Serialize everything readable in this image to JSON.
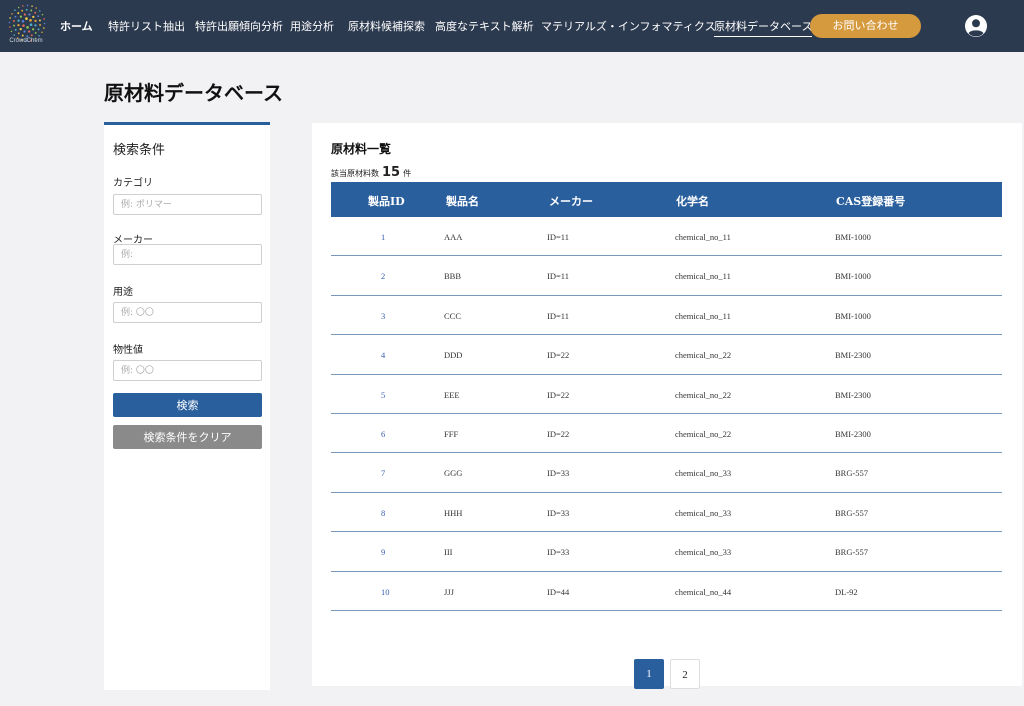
{
  "header": {
    "logo_text": "CrowdChem",
    "nav": [
      {
        "label": "ホーム"
      },
      {
        "label": "特許リスト抽出"
      },
      {
        "label": "特許出願傾向分析"
      },
      {
        "label": "用途分析"
      },
      {
        "label": "原材料候補探索"
      },
      {
        "label": "高度なテキスト解析"
      },
      {
        "label": "マテリアルズ・インフォマティクス"
      },
      {
        "label": "原材料データベース"
      }
    ],
    "contact_label": "お問い合わせ",
    "colors": {
      "bar": "#2c3a4f",
      "accent": "#d69a3e"
    }
  },
  "page": {
    "title": "原材料データベース"
  },
  "sidebar": {
    "title": "検索条件",
    "fields": [
      {
        "label": "カテゴリ",
        "placeholder": "例: ポリマー"
      },
      {
        "label": "メーカー",
        "placeholder": "例:"
      },
      {
        "label": "用途",
        "placeholder": "例: 〇〇"
      },
      {
        "label": "物性値",
        "placeholder": "例: 〇〇"
      }
    ],
    "search_label": "検索",
    "clear_label": "検索条件をクリア"
  },
  "main": {
    "title": "原材料一覧",
    "count_prefix": "該当原材料数",
    "count": "15",
    "count_suffix": "件",
    "columns": [
      "製品ID",
      "製品名",
      "メーカー",
      "化学名",
      "CAS登録番号"
    ],
    "rows": [
      [
        "1",
        "AAA",
        "ID=11",
        "chemical_no_11",
        "BMI-1000"
      ],
      [
        "2",
        "BBB",
        "ID=11",
        "chemical_no_11",
        "BMI-1000"
      ],
      [
        "3",
        "CCC",
        "ID=11",
        "chemical_no_11",
        "BMI-1000"
      ],
      [
        "4",
        "DDD",
        "ID=22",
        "chemical_no_22",
        "BMI-2300"
      ],
      [
        "5",
        "EEE",
        "ID=22",
        "chemical_no_22",
        "BMI-2300"
      ],
      [
        "6",
        "FFF",
        "ID=22",
        "chemical_no_22",
        "BMI-2300"
      ],
      [
        "7",
        "GGG",
        "ID=33",
        "chemical_no_33",
        "BRG-557"
      ],
      [
        "8",
        "HHH",
        "ID=33",
        "chemical_no_33",
        "BRG-557"
      ],
      [
        "9",
        "III",
        "ID=33",
        "chemical_no_33",
        "BRG-557"
      ],
      [
        "10",
        "JJJ",
        "ID=44",
        "chemical_no_44",
        "DL-92"
      ]
    ],
    "pagination": {
      "current": "1",
      "pages": [
        "1",
        "2"
      ]
    },
    "colors": {
      "table_header": "#2a5f9e",
      "link": "#3a5fb0"
    }
  }
}
